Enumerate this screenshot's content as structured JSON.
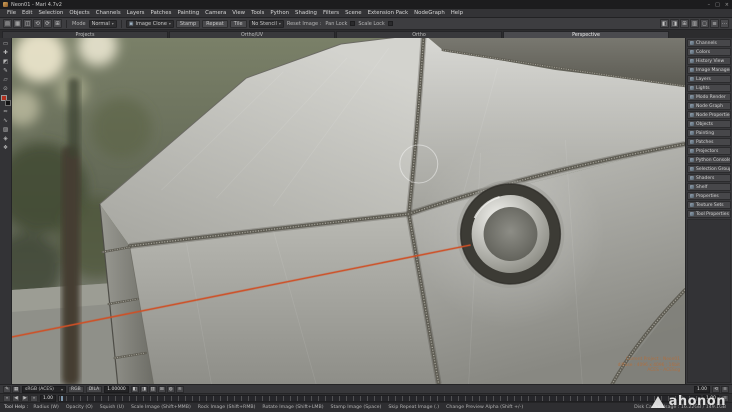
{
  "window": {
    "title": "Neon01 - Mari 4.7v2",
    "min": "–",
    "max": "□",
    "close": "×"
  },
  "icons": {
    "caret": "▾"
  },
  "menubar": {
    "items": [
      "File",
      "Edit",
      "Selection",
      "Objects",
      "Channels",
      "Layers",
      "Patches",
      "Painting",
      "Camera",
      "View",
      "Tools",
      "Python",
      "Shading",
      "Filters",
      "Scene",
      "Extension Pack",
      "NodeGraph",
      "Help"
    ]
  },
  "toolbar": {
    "left_icons": [
      {
        "name": "new-project-icon",
        "glyph": "▤"
      },
      {
        "name": "open-project-icon",
        "glyph": "▦"
      },
      {
        "name": "save-icon",
        "glyph": "◫"
      },
      {
        "name": "undo-icon",
        "glyph": "⟲"
      },
      {
        "name": "redo-icon",
        "glyph": "⟳"
      },
      {
        "name": "add-channel-icon",
        "glyph": "⊞"
      }
    ],
    "mode_label": "Mode",
    "mode_value": "Normal",
    "tool_name": "Image Clone",
    "stamp": "Stamp",
    "repeat": "Repeat",
    "tile": "Tile",
    "stencil": "No Stencil",
    "reset_label": "Reset Image :",
    "pan_lock": "Pan Lock",
    "scale_lock": "Scale Lock",
    "right_icons": [
      {
        "name": "mirror-horizontal-icon",
        "glyph": "◧"
      },
      {
        "name": "mirror-vertical-icon",
        "glyph": "◨"
      },
      {
        "name": "grid-snap-icon",
        "glyph": "⊞"
      },
      {
        "name": "overlay-icon",
        "glyph": "▥"
      },
      {
        "name": "isolate-select-icon",
        "glyph": "◻"
      },
      {
        "name": "list-view-icon",
        "glyph": "≡"
      },
      {
        "name": "more-options-icon",
        "glyph": "⋯"
      }
    ]
  },
  "tabs": {
    "items": [
      "Projects",
      "Ortho/UV",
      "Ortho",
      "Perspective"
    ]
  },
  "tools": {
    "top": [
      {
        "name": "select-tool",
        "glyph": "▭"
      },
      {
        "name": "transform-tool",
        "glyph": "✚"
      },
      {
        "name": "marquee-select-tool",
        "glyph": "◩"
      },
      {
        "name": "paint-tool",
        "glyph": "✎"
      },
      {
        "name": "eraser-tool",
        "glyph": "▱"
      },
      {
        "name": "clone-stamp-tool",
        "glyph": "⊙"
      }
    ],
    "bottom": [
      {
        "name": "blur-tool",
        "glyph": "≈"
      },
      {
        "name": "smear-tool",
        "glyph": "∿"
      },
      {
        "name": "gradient-tool",
        "glyph": "▨"
      },
      {
        "name": "vector-paint-tool",
        "glyph": "◈"
      },
      {
        "name": "color-picker-tool",
        "glyph": "❖"
      }
    ],
    "foreground_color": "#b2301f",
    "background_color": "#141414"
  },
  "right_panel": {
    "items": [
      "Channels",
      "Colors",
      "History View",
      "Image Manager",
      "Layers",
      "Lights",
      "Modo Render",
      "Node Graph",
      "Node Properties",
      "Objects",
      "Painting",
      "Patches",
      "Projectors",
      "Python Console",
      "Selection Groups",
      "Shaders",
      "Shelf",
      "Properties",
      "Texture Sets",
      "Tool Properties"
    ]
  },
  "hud": {
    "lines": [
      "Current Project : Neon01",
      "diffuse : 4096 x 4096 : 16bit",
      "ACES - ACEScg"
    ]
  },
  "paintbar": {
    "left_icons": [
      {
        "name": "paint-buffer-icon",
        "glyph": "✎"
      },
      {
        "name": "projection-icon",
        "glyph": "▦"
      }
    ],
    "colorspace": "sRGB (ACES)",
    "rgb_button": "RGB",
    "dila_button": "DILA",
    "value": "1.00000",
    "mid_icons": [
      {
        "name": "mask-left-icon",
        "glyph": "◧"
      },
      {
        "name": "mask-right-icon",
        "glyph": "◨"
      },
      {
        "name": "channel-view-icon",
        "glyph": "▥"
      },
      {
        "name": "grid-icon",
        "glyph": "⊞"
      },
      {
        "name": "falloff-icon",
        "glyph": "◍"
      },
      {
        "name": "wave-icon",
        "glyph": "≋"
      }
    ],
    "right_value": "1.00",
    "right_icons": [
      {
        "name": "reset-view-icon",
        "glyph": "⟲"
      },
      {
        "name": "options-menu-icon",
        "glyph": "≡"
      }
    ]
  },
  "timeline": {
    "transport": [
      {
        "name": "go-to-start-button",
        "glyph": "«"
      },
      {
        "name": "previous-frame-button",
        "glyph": "◀"
      },
      {
        "name": "play-button",
        "glyph": "▶"
      },
      {
        "name": "go-to-end-button",
        "glyph": "»"
      }
    ],
    "start": "1.00",
    "current": "1.00",
    "options_icon": "≡"
  },
  "statusbar": {
    "label": "Tool Help :",
    "segments": [
      "Radius (W)",
      "Opacity (O)",
      "Squish (U)",
      "Scale Image (Shift+MMB)",
      "Rock Image (Shift+RMB)",
      "Rotate Image (Shift+LMB)",
      "Stamp Image (Space)",
      "Skip Repeat Image (.)",
      "Change Preview Alpha (Shift +/-)"
    ],
    "cache": "Disk Cache Usage : 16.22GB / 149.1GB"
  },
  "watermark": {
    "text": "ahonon"
  },
  "colors": {
    "accent_line": "#cf5026",
    "weld": "#5f5d54",
    "panel_bg": "#39393c"
  }
}
